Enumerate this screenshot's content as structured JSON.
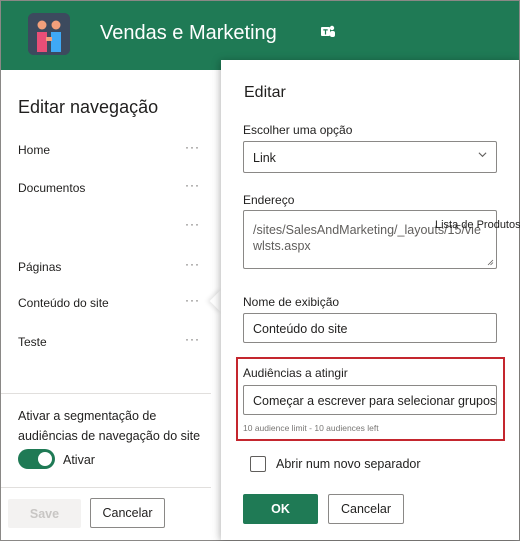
{
  "header": {
    "site_title": "Vendas e Marketing",
    "logo": "people-handshake-logo",
    "teams_icon": "teams-icon",
    "bg_color": "#1f7a55"
  },
  "left_panel": {
    "title": "Editar navegação",
    "items": [
      {
        "label": "Home"
      },
      {
        "label": "Documentos"
      },
      {
        "label": ""
      },
      {
        "label": "Páginas"
      },
      {
        "label": "Conteúdo do site"
      },
      {
        "label": "Teste"
      }
    ],
    "more_icon": "more-options-icon",
    "audience_text": "Ativar a segmentação de audiências de navegação do site",
    "toggle_label": "Ativar",
    "toggle_on": true,
    "save_label": "Save",
    "cancel_label": "Cancelar"
  },
  "edit_panel": {
    "title": "Editar",
    "choose_label": "Escolher uma opção",
    "choose_value": "Link",
    "address_label": "Endereço",
    "address_value": "/sites/SalesAndMarketing/_layouts/15/viewlsts.aspx",
    "overlap_text": "Lista de Produtos",
    "display_name_label": "Nome de exibição",
    "display_name_value": "Conteúdo do site",
    "audiences_label": "Audiências a atingir",
    "audiences_placeholder": "Começar a escrever para selecionar grupos",
    "audiences_hint": "10 audience limit - 10 audiences left",
    "new_tab_label": "Abrir num novo separador",
    "ok_label": "OK",
    "cancel_label": "Cancelar",
    "highlight_color": "#c4262e"
  }
}
